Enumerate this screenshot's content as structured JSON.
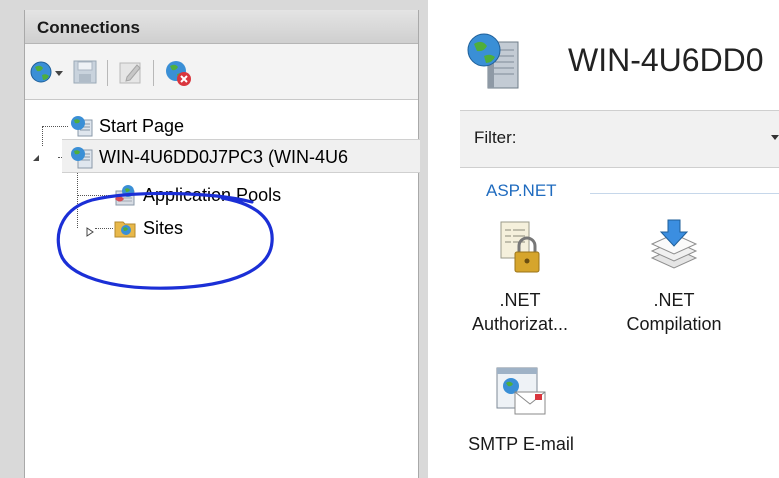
{
  "connections": {
    "header": "Connections",
    "toolbar": [
      {
        "name": "connect-globe-icon"
      },
      {
        "name": "save-icon"
      },
      {
        "name": "edit-icon"
      },
      {
        "name": "disconnect-icon"
      }
    ],
    "tree": {
      "start_page": "Start Page",
      "server": "WIN-4U6DD0J7PC3 (WIN-4U6",
      "app_pools": "Application Pools",
      "sites": "Sites"
    }
  },
  "main": {
    "title": "WIN-4U6DD0",
    "filter_label": "Filter:",
    "filter_value": "",
    "group": "ASP.NET",
    "features": [
      {
        "line1": ".NET",
        "line2": "Authorizat...",
        "icon": "authorization-lock-icon"
      },
      {
        "line1": ".NET",
        "line2": "Compilation",
        "icon": "compilation-stack-icon"
      },
      {
        "line1": "SMTP E-mail",
        "line2": "",
        "icon": "smtp-email-icon"
      }
    ]
  },
  "colors": {
    "accent": "#1f6bbf",
    "annotation": "#1b2fd6"
  }
}
